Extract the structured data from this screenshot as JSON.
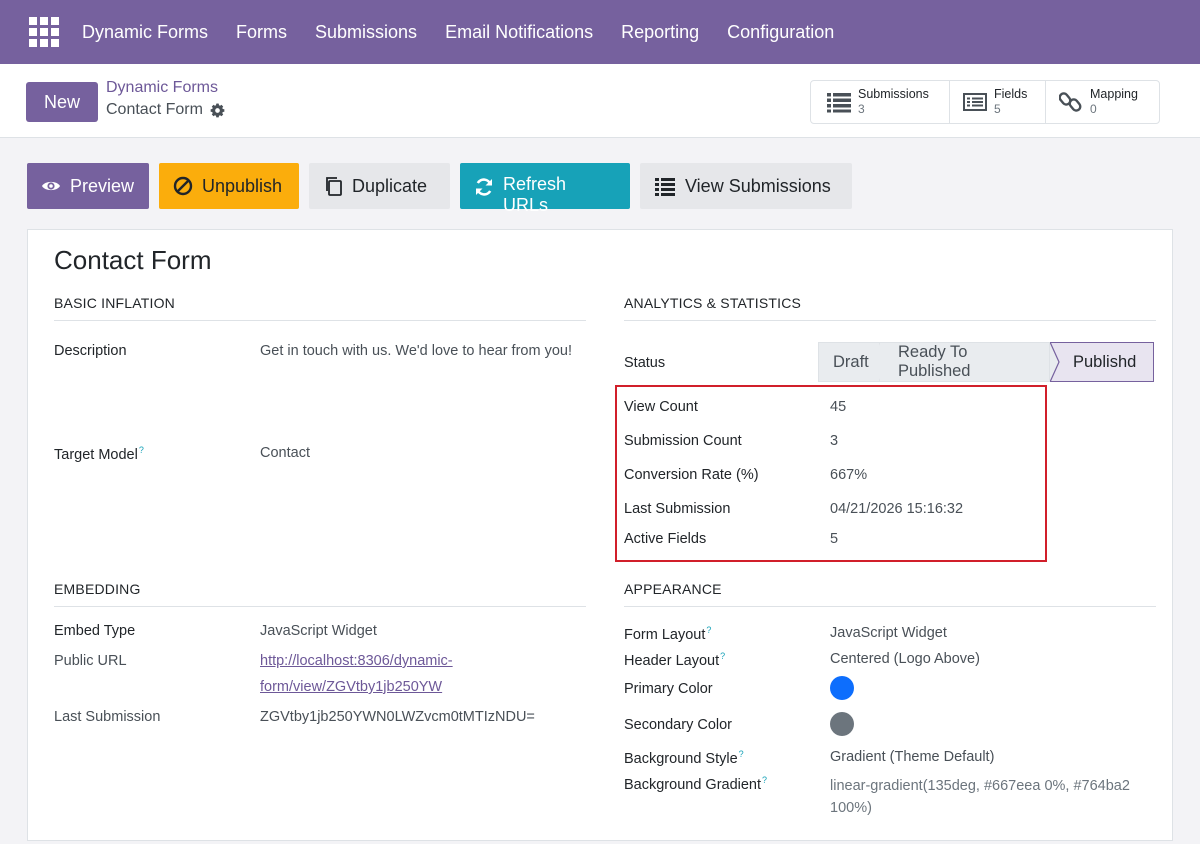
{
  "navbar": {
    "brand": "Dynamic Forms",
    "items": [
      "Forms",
      "Submissions",
      "Email Notifications",
      "Reporting",
      "Configuration"
    ]
  },
  "control": {
    "new_label": "New",
    "breadcrumb_parent": "Dynamic Forms",
    "breadcrumb_current": "Contact Form",
    "smart_buttons": [
      {
        "label": "Submissions",
        "value": "3",
        "icon": "list-icon"
      },
      {
        "label": "Fields",
        "value": "5",
        "icon": "fields-list-icon"
      },
      {
        "label": "Mapping",
        "value": "0",
        "icon": "link-icon"
      }
    ]
  },
  "actions": {
    "preview": "Preview",
    "unpublish": "Unpublish",
    "duplicate": "Duplicate",
    "refresh": "Refresh URLs",
    "view_submissions": "View Submissions"
  },
  "form": {
    "title": "Contact Form",
    "basic": {
      "heading": "BASIC INFLATION",
      "description_label": "Description",
      "description_value": "Get in touch with us. We'd love to hear from you!",
      "target_model_label": "Target Model",
      "target_model_value": "Contact"
    },
    "analytics": {
      "heading": "ANALYTICS & STATISTICS",
      "status_label": "Status",
      "stages": [
        "Draft",
        "Ready To Published",
        "Publishd"
      ],
      "active_stage": "Publishd",
      "view_count_label": "View Count",
      "view_count": "45",
      "submission_count_label": "Submission Count",
      "submission_count": "3",
      "conversion_label": "Conversion Rate (%)",
      "conversion": "667%",
      "last_submission_label": "Last Submission",
      "last_submission": "04/21/2026 15:16:32",
      "active_fields_label": "Active Fields",
      "active_fields": "5"
    },
    "embedding": {
      "heading": "EMBEDDING",
      "embed_type_label": "Embed Type",
      "embed_type": "JavaScript Widget",
      "public_url_label": "Public URL",
      "public_url_line1": "http://localhost:8306/dynamic-",
      "public_url_line2": "form/view/ZGVtby1jb250YW",
      "last_submission_label": "Last Submission",
      "last_submission": "ZGVtby1jb250YWN0LWZvcm0tMTIzNDU="
    },
    "appearance": {
      "heading": "APPEARANCE",
      "form_layout_label": "Form Layout",
      "form_layout": "JavaScript Widget",
      "header_layout_label": "Header Layout",
      "header_layout": "Centered (Logo Above)",
      "primary_color_label": "Primary Color",
      "primary_color": "#0d6efd",
      "secondary_color_label": "Secondary Color",
      "secondary_color": "#6c757d",
      "bg_style_label": "Background Style",
      "bg_style": "Gradient (Theme Default)",
      "bg_gradient_label": "Background Gradient",
      "bg_gradient_line1": "linear-gradient(135deg, #667eea 0%, #764ba2",
      "bg_gradient_line2": "100%)"
    }
  }
}
